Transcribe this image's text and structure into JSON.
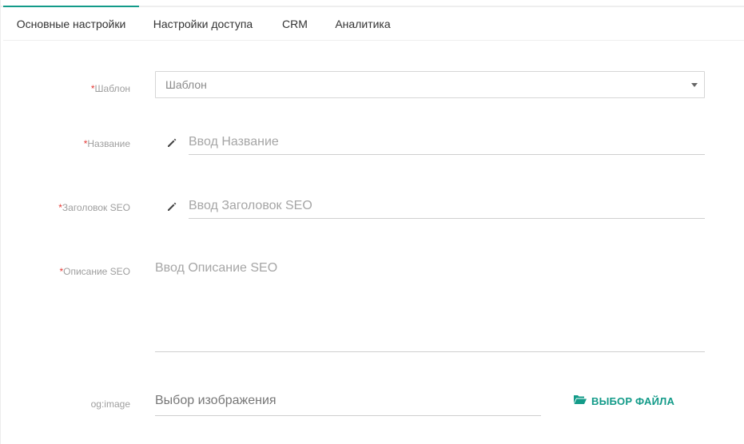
{
  "tabs": [
    {
      "label": "Основные настройки",
      "active": true
    },
    {
      "label": "Настройки доступа",
      "active": false
    },
    {
      "label": "CRM",
      "active": false
    },
    {
      "label": "Аналитика",
      "active": false
    }
  ],
  "form": {
    "required_mark": "*",
    "template": {
      "label": "Шаблон",
      "value": "Шаблон"
    },
    "name": {
      "label": "Название",
      "placeholder": "Ввод Название"
    },
    "seo_title": {
      "label": "Заголовок SEO",
      "placeholder": "Ввод Заголовок SEO"
    },
    "seo_description": {
      "label": "Описание SEO",
      "placeholder": "Ввод Описание SEO"
    },
    "og_image": {
      "label": "og:image",
      "placeholder": "Выбор изображения",
      "button_label": "ВЫБОР ФАЙЛА"
    }
  },
  "icons": {
    "edit": "pencil-icon",
    "caret": "caret-down-icon",
    "folder": "folder-open-icon"
  },
  "colors": {
    "accent": "#139b89",
    "required": "#e53935"
  }
}
